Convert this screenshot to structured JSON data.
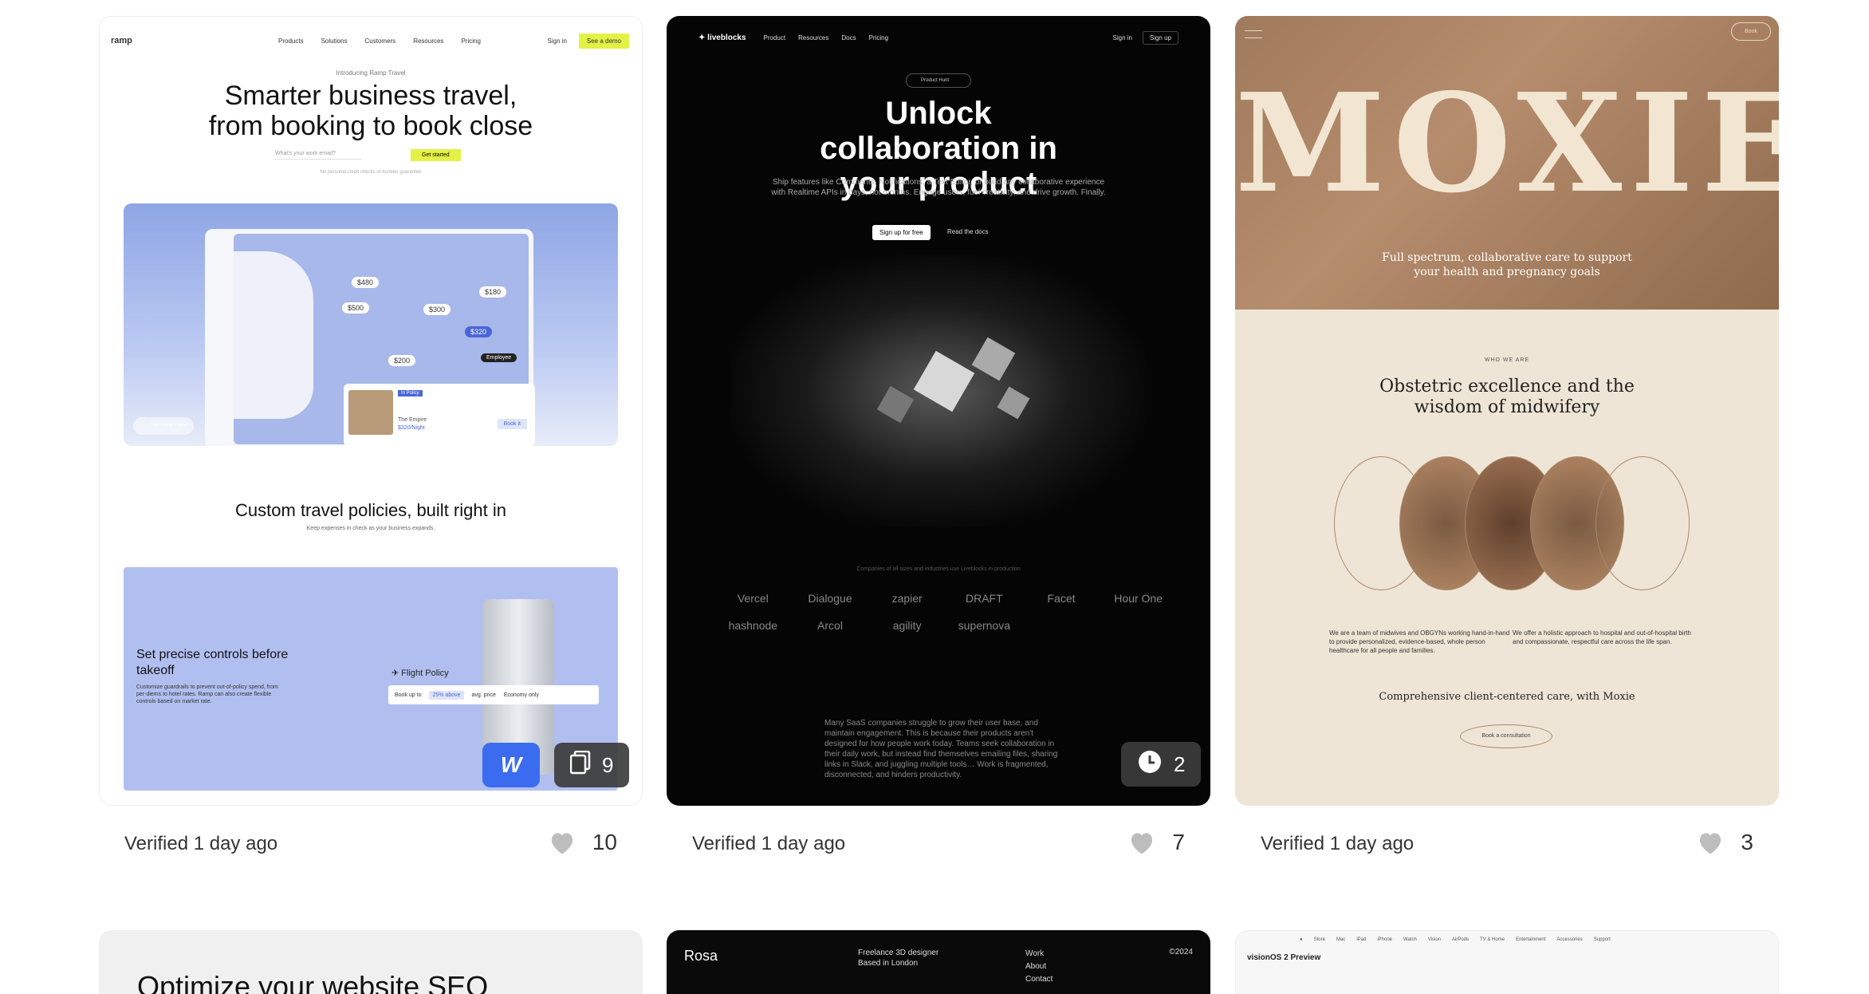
{
  "cards": [
    {
      "verified": "Verified 1 day ago",
      "likes": "10",
      "badge_count": "9",
      "preview": {
        "nav_logo": "ramp",
        "nav_links": [
          "Products",
          "Solutions",
          "Customers",
          "Resources",
          "Pricing"
        ],
        "sign_in": "Sign in",
        "demo": "See a demo",
        "intro": "Introducing Ramp Travel",
        "headline": "Smarter business travel, from booking to book close",
        "email_placeholder": "What's your work email?",
        "cta": "Get started",
        "note": "No personal credit checks or founder guarantee",
        "prices": [
          "$480",
          "$180",
          "$500",
          "$300",
          "$320",
          "$200"
        ],
        "employee": "Employee",
        "hotel_tag": "In Policy",
        "hotel_name": "The Empire",
        "hotel_price": "$320/Night",
        "book": "Book it",
        "pill": "See Ramp Travel",
        "section_title": "Custom travel policies, built right in",
        "section_sub": "Keep expenses in check as your business expands.",
        "panel_title": "Set precise controls before takeoff",
        "panel_text": "Customize guardrails to prevent out-of-policy spend, from per-diems to hotel rates. Ramp can also create flexible controls based on market rate.",
        "flight_policy": "Flight Policy",
        "rule_book": "Book up to",
        "rule_pct": "25% above",
        "rule_avg": "avg. price",
        "rule_economy": "Economy only"
      }
    },
    {
      "verified": "Verified 1 day ago",
      "likes": "7",
      "badge_count": "2",
      "preview": {
        "nav_logo": "liveblocks",
        "nav_links": [
          "Product",
          "Resources",
          "Docs",
          "Pricing"
        ],
        "sign_in": "Sign in",
        "sign_up": "Sign up",
        "product_hunt": "Product Hunt",
        "headline": "Unlock collaboration in your product",
        "body": "Ship features like Comments, Notifications, a Text Editor, or build any collaborative experience with Realtime APIs in days, not months. Engage users, fuel creativity, and drive growth. Finally.",
        "cta_primary": "Sign up for free",
        "cta_secondary": "Read the docs",
        "companies_note": "Companies of all sizes and industries use Liveblocks in production",
        "logos": [
          "Vercel",
          "Dialogue",
          "zapier",
          "DRAFT",
          "Facet",
          "Hour One",
          "hashnode",
          "Arcol",
          "agility",
          "supernova"
        ],
        "bottom_text": "Many SaaS companies struggle to grow their user base, and maintain engagement. This is because their products aren't designed for how people work today. Teams seek collaboration in their daily work, but instead find themselves emailing files, sharing links in Slack, and juggling multiple tools… Work is fragmented, disconnected, and hinders productivity."
      }
    },
    {
      "verified": "Verified 1 day ago",
      "likes": "3",
      "preview": {
        "wordmark": "MOXIE",
        "book_btn": "Book",
        "tagline": "Full spectrum, collaborative care to support your health and pregnancy goals",
        "who": "WHO WE ARE",
        "headline": "Obstetric excellence and the wisdom of midwifery",
        "col1": "We are a team of midwives and OBGYNs working hand-in-hand to provide personalized, evidence-based, whole person healthcare for all people and families.",
        "col2": "We offer a holistic approach to hospital and out-of-hospital birth and compassionate, respectful care across the life span.",
        "comprehensive": "Comprehensive client-centered care, with Moxie",
        "consult": "Book a consultation"
      }
    }
  ],
  "row2": [
    {
      "title": "Optimize your website SEO"
    },
    {
      "logo": "Rosa",
      "sub": "Freelance 3D designer Based in London",
      "menu": [
        "Work",
        "About",
        "Contact"
      ],
      "year": "©2024"
    },
    {
      "nav": [
        "Store",
        "Mac",
        "iPad",
        "iPhone",
        "Watch",
        "Vision",
        "AirPods",
        "TV & Home",
        "Entertainment",
        "Accessories",
        "Support"
      ],
      "title": "visionOS 2 Preview"
    }
  ],
  "colors": {
    "ramp_lime": "#e4f145",
    "ramp_blue": "#4a66d8",
    "webflow_blue": "#3b6cf0",
    "moxie_cream": "#efe5d6"
  }
}
